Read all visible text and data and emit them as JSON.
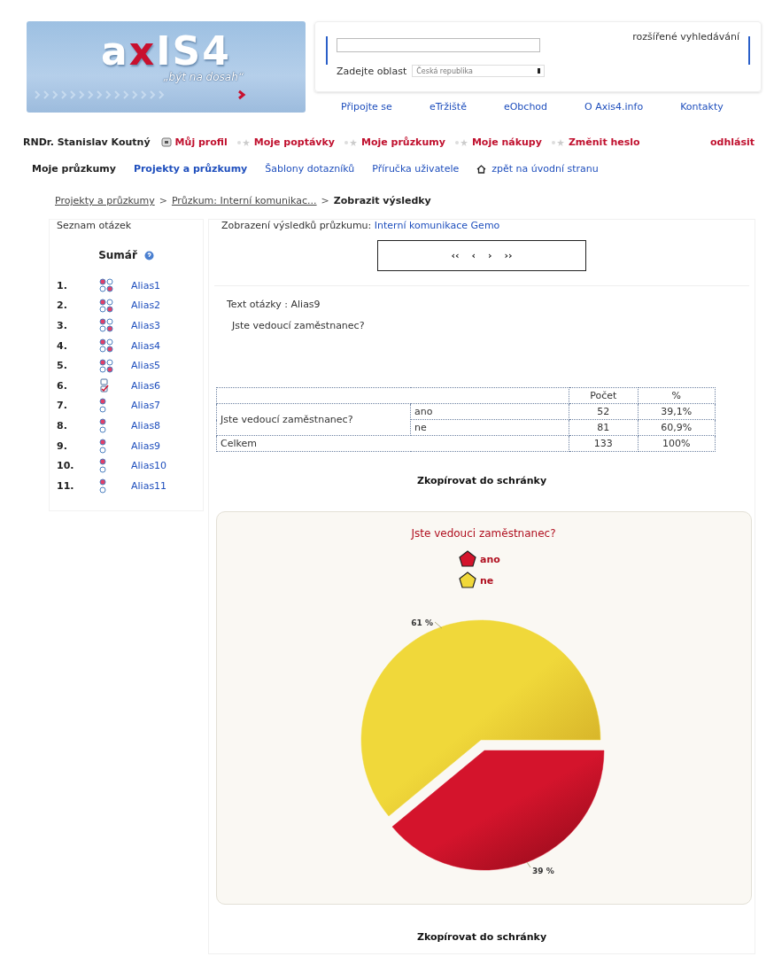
{
  "logo": {
    "parts": [
      {
        "text": "a",
        "accent": false
      },
      {
        "text": "x",
        "accent": true
      },
      {
        "text": "IS4",
        "accent": false
      }
    ],
    "tagline": "„být na dosah“"
  },
  "search": {
    "advanced_link": "rozšířené vyhledávání",
    "area_label": "Zadejte oblast",
    "area_value": "Česká republika"
  },
  "top_nav": [
    "Připojte se",
    "eTržiště",
    "eObchod",
    "O Axis4.info",
    "Kontakty"
  ],
  "user_bar": {
    "name": "RNDr. Stanislav Koutný",
    "links": [
      "Můj profil",
      "Moje poptávky",
      "Moje průzkumy",
      "Moje nákupy",
      "Změnit heslo"
    ],
    "logout": "odhlásit"
  },
  "section_label": "Moje průzkumy",
  "tabs": [
    {
      "label": "Projekty a průzkumy",
      "selected": true
    },
    {
      "label": "Šablony dotazníků",
      "selected": false
    },
    {
      "label": "Příručka uživatele",
      "selected": false
    },
    {
      "label": "zpět na úvodní stranu",
      "selected": false,
      "kind": "home"
    }
  ],
  "breadcrumb": [
    {
      "kind": "link",
      "text": "Projekty a průzkumy"
    },
    {
      "kind": "sep",
      "text": ">"
    },
    {
      "kind": "link",
      "text": "Průzkum: Interní komunikac..."
    },
    {
      "kind": "sep",
      "text": ">"
    },
    {
      "kind": "current",
      "text": "Zobrazit výsledky"
    }
  ],
  "sidebar": {
    "title": "Seznam otázek",
    "summary": "Sumář",
    "questions": [
      {
        "number": "1.",
        "alias": "Alias1",
        "kind": "matrix"
      },
      {
        "number": "2.",
        "alias": "Alias2",
        "kind": "matrix"
      },
      {
        "number": "3.",
        "alias": "Alias3",
        "kind": "matrix"
      },
      {
        "number": "4.",
        "alias": "Alias4",
        "kind": "matrix"
      },
      {
        "number": "5.",
        "alias": "Alias5",
        "kind": "matrix"
      },
      {
        "number": "6.",
        "alias": "Alias6",
        "kind": "checkbox"
      },
      {
        "number": "7.",
        "alias": "Alias7",
        "kind": "radio"
      },
      {
        "number": "8.",
        "alias": "Alias8",
        "kind": "radio"
      },
      {
        "number": "9.",
        "alias": "Alias9",
        "kind": "radio"
      },
      {
        "number": "10.",
        "alias": "Alias10",
        "kind": "radio"
      },
      {
        "number": "11.",
        "alias": "Alias11",
        "kind": "radio"
      }
    ]
  },
  "results": {
    "heading": "Zobrazení výsledků průzkumu:",
    "survey_name": "Interní komunikace Gemo",
    "pager": [
      "‹‹",
      "‹",
      "›",
      "››"
    ],
    "question_label": "Text otázky : Alias9",
    "question_text": "Jste vedoucí zaměstnanec?",
    "table": {
      "columns": [
        "",
        "Počet",
        "%"
      ],
      "question": "Jste vedoucí zaměstnanec?",
      "rows": [
        {
          "answer": "ano",
          "count": "52",
          "percent": "39,1%"
        },
        {
          "answer": "ne",
          "count": "81",
          "percent": "60,9%"
        }
      ],
      "total": {
        "label": "Celkem",
        "count": "133",
        "percent": "100%"
      }
    },
    "copy_button_1": "Zkopírovat do schránky",
    "chart": {
      "chart_data": {
        "type": "pie",
        "title": "Jste vedouci zaměstnanec?",
        "categories": [
          "ano",
          "ne"
        ],
        "values": [
          39,
          61
        ],
        "colors": [
          "#d4142c",
          "#f0d83a"
        ],
        "legend": true,
        "value_labels": [
          "39 %",
          "61 %"
        ]
      }
    },
    "copy_button_2": "Zkopírovat do schránky"
  }
}
